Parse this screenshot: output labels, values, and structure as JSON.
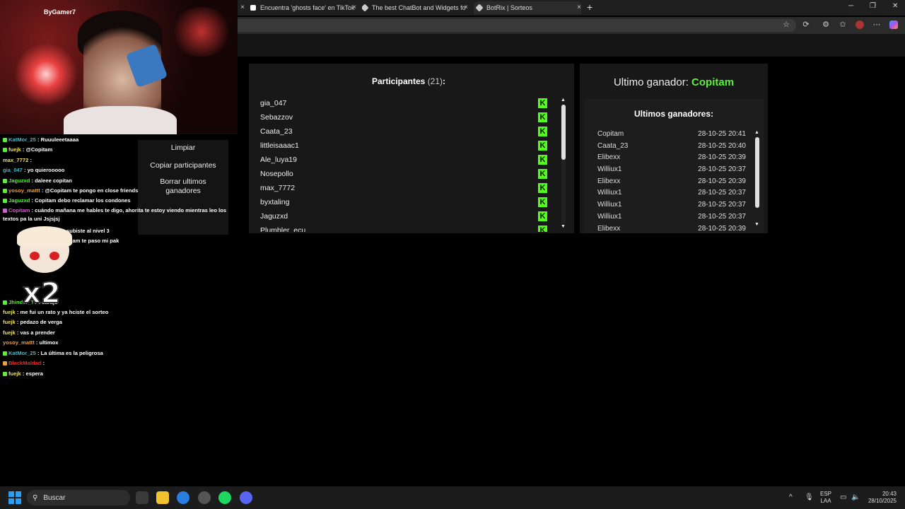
{
  "browser": {
    "tabs": [
      {
        "title": "Encuentra 'ghosts face' en TikTok",
        "icon": "tiktok-icon"
      },
      {
        "title": "The best ChatBot and Widgets fo",
        "icon": "botrix-icon"
      },
      {
        "title": "BotRix | Sorteos",
        "icon": "botrix-icon"
      }
    ],
    "new_tab": "+",
    "close_glyph": "×"
  },
  "participants": {
    "title": "Participantes",
    "count": "(21)",
    "suffix": ":",
    "platform_glyph": "K",
    "platform_color": "#53fc18",
    "names": [
      "gia_047",
      "Sebazzov",
      "Caata_23",
      "littleisaaac1",
      "Ale_luya19",
      "Nosepollo",
      "max_7772",
      "byxtaling",
      "Jaguzxd",
      "Plumbler_ecu"
    ]
  },
  "winner": {
    "label": "Ultimo ganador:",
    "name": "Copitam",
    "accent": "#5cf03a"
  },
  "last_winners": {
    "title": "Ultimos ganadores:",
    "rows": [
      {
        "name": "Copitam",
        "time": "28-10-25 20:41"
      },
      {
        "name": "Caata_23",
        "time": "28-10-25 20:40"
      },
      {
        "name": "Elibexx",
        "time": "28-10-25 20:39"
      },
      {
        "name": "Williux1",
        "time": "28-10-25 20:37"
      },
      {
        "name": "Elibexx",
        "time": "28-10-25 20:39"
      },
      {
        "name": "Williux1",
        "time": "28-10-25 20:37"
      },
      {
        "name": "Williux1",
        "time": "28-10-25 20:37"
      },
      {
        "name": "Williux1",
        "time": "28-10-25 20:37"
      },
      {
        "name": "Elibexx",
        "time": "28-10-25 20:39"
      }
    ]
  },
  "actions": {
    "clear": "Limpiar",
    "copy": "Copiar participantes",
    "delete_winners": "Borrar ultimos ganadores"
  },
  "stream": {
    "logo": "ByGamer7"
  },
  "chat": [
    {
      "user": "KatMor_25",
      "color": "#48b5c8",
      "text": ": Ruuuleeetaaaa"
    },
    {
      "user": "fuejk",
      "color": "#e8e070",
      "text": ": @Copitam"
    },
    {
      "user": "max_7772",
      "color": "#e8e070",
      "text": ":"
    },
    {
      "user": "gia_047",
      "color": "#48b5c8",
      "text": ": yo quierooooo"
    },
    {
      "user": "Jaguzxd",
      "color": "#5cf03a",
      "text": ": daleee copitan"
    },
    {
      "user": "yosoy_mattt",
      "color": "#e8a040",
      "text": ": @Copitam te pongo en close friends"
    },
    {
      "user": "Jaguzxd",
      "color": "#5cf03a",
      "text": ": Copitam debo reclamar los condones"
    },
    {
      "user": "Copitam",
      "color": "#d060d0",
      "text": ": cuándo mañana me hables te digo, ahorita te estoy viendo mientras leo los textos pa la uni Jsjsjsj"
    },
    {
      "user": "",
      "color": "#fff",
      "text": "subiste al nivel 3"
    },
    {
      "user": "",
      "color": "#fff",
      "text": "tam te paso mi pak"
    },
    {
      "user": "Jhinder_Tv",
      "color": "#5cf03a",
      "text": ": carajo"
    },
    {
      "user": "fuejk",
      "color": "#e8e070",
      "text": ": me fui un rato y ya hciste el sorteo"
    },
    {
      "user": "fuejk",
      "color": "#e8e070",
      "text": ": pedazo de verga"
    },
    {
      "user": "fuejk",
      "color": "#e8e070",
      "text": ": vas a prender"
    },
    {
      "user": "yosoy_mattt",
      "color": "#e8a040",
      "text": ": ultimox"
    },
    {
      "user": "KatMor_25",
      "color": "#48b5c8",
      "text": ": La última es la peligrosa"
    },
    {
      "user": "BlackMaldad",
      "color": "#e03030",
      "text": ":"
    },
    {
      "user": "fuejk",
      "color": "#e8e070",
      "text": ": espera"
    }
  ],
  "sticker_text": "x2",
  "taskbar": {
    "search_placeholder": "Buscar",
    "lang_line1": "ESP",
    "lang_line2": "LAA",
    "time": "20:43",
    "date": "28/10/2025"
  }
}
